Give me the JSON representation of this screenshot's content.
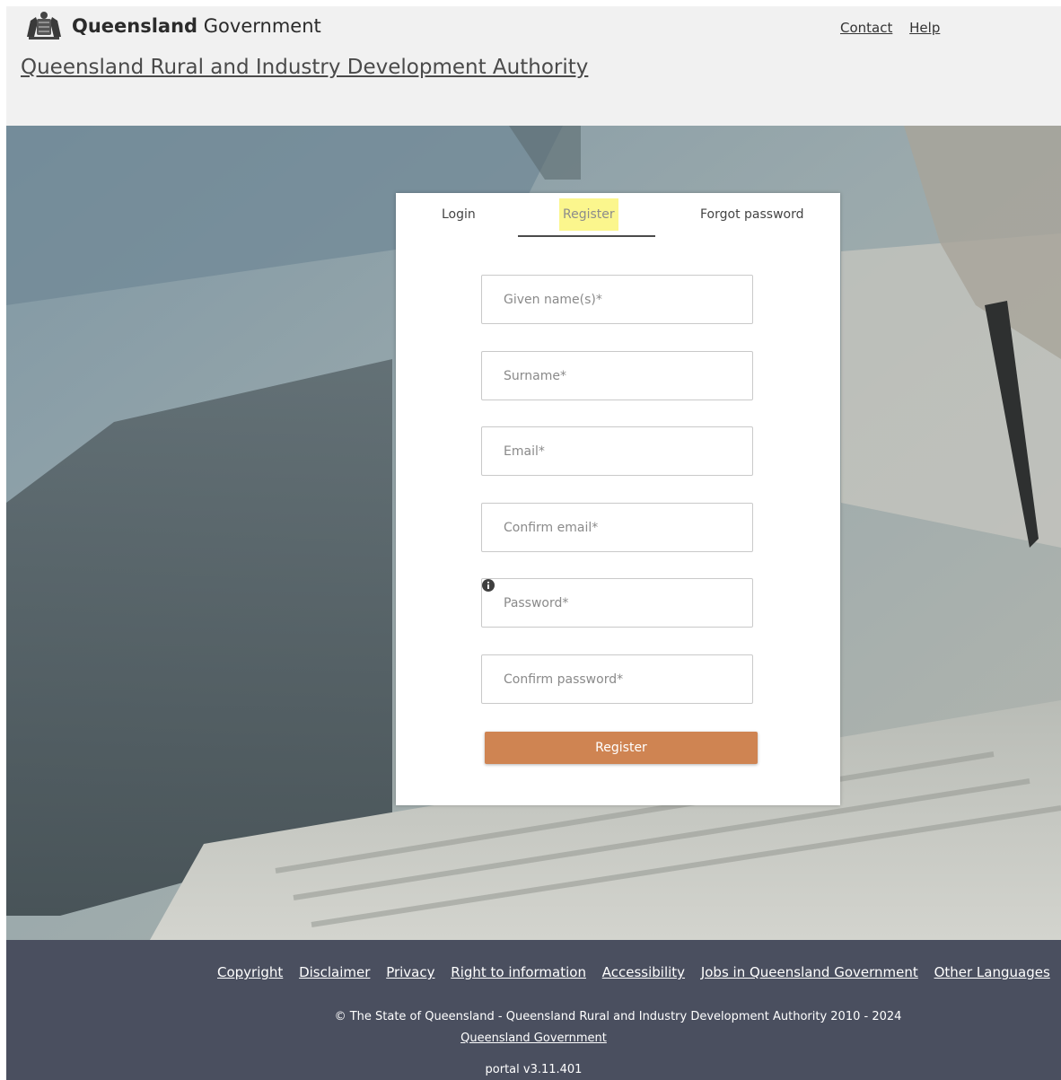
{
  "header": {
    "logo_bold": "Queensland",
    "logo_regular": "Government",
    "agency_name": "Queensland Rural and Industry Development Authority",
    "links": {
      "contact": "Contact",
      "help": "Help"
    }
  },
  "card": {
    "tabs": {
      "login": "Login",
      "register": "Register",
      "forgot": "Forgot password"
    },
    "active_tab": "Register",
    "fields": {
      "given_name": "Given name(s)*",
      "surname": "Surname*",
      "email": "Email*",
      "confirm_email": "Confirm email*",
      "password": "Password*",
      "confirm_password": "Confirm password*"
    },
    "submit_label": "Register"
  },
  "footer": {
    "links": {
      "copyright": "Copyright",
      "disclaimer": "Disclaimer",
      "privacy": "Privacy",
      "right_to_information": "Right to information",
      "accessibility": "Accessibility",
      "jobs": "Jobs in Queensland Government",
      "other_languages": "Other Languages"
    },
    "copyright_text": "© The State of Queensland - Queensland Rural and Industry Development Authority 2010 - 2024",
    "gov_link": "Queensland Government",
    "version": "portal v3.11.401"
  },
  "colors": {
    "header_bg": "#f1f1f1",
    "footer_bg": "#4a4f5f",
    "button_bg": "#cf8452",
    "highlight": "#fbf68d"
  }
}
